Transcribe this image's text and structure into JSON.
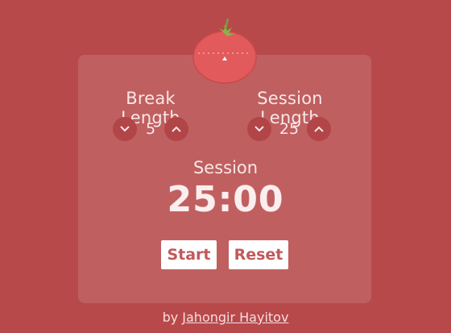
{
  "break": {
    "label": "Break Length",
    "value": "5"
  },
  "session": {
    "label": "Session Length",
    "value": "25"
  },
  "timer": {
    "mode": "Session",
    "time": "25:00"
  },
  "buttons": {
    "start": "Start",
    "reset": "Reset"
  },
  "footer": {
    "prefix": "by",
    "author": "Jahongir Hayitov"
  },
  "colors": {
    "background": "#b8494b",
    "tomato": "#e25a5c",
    "leaf": "#8cb04a"
  }
}
